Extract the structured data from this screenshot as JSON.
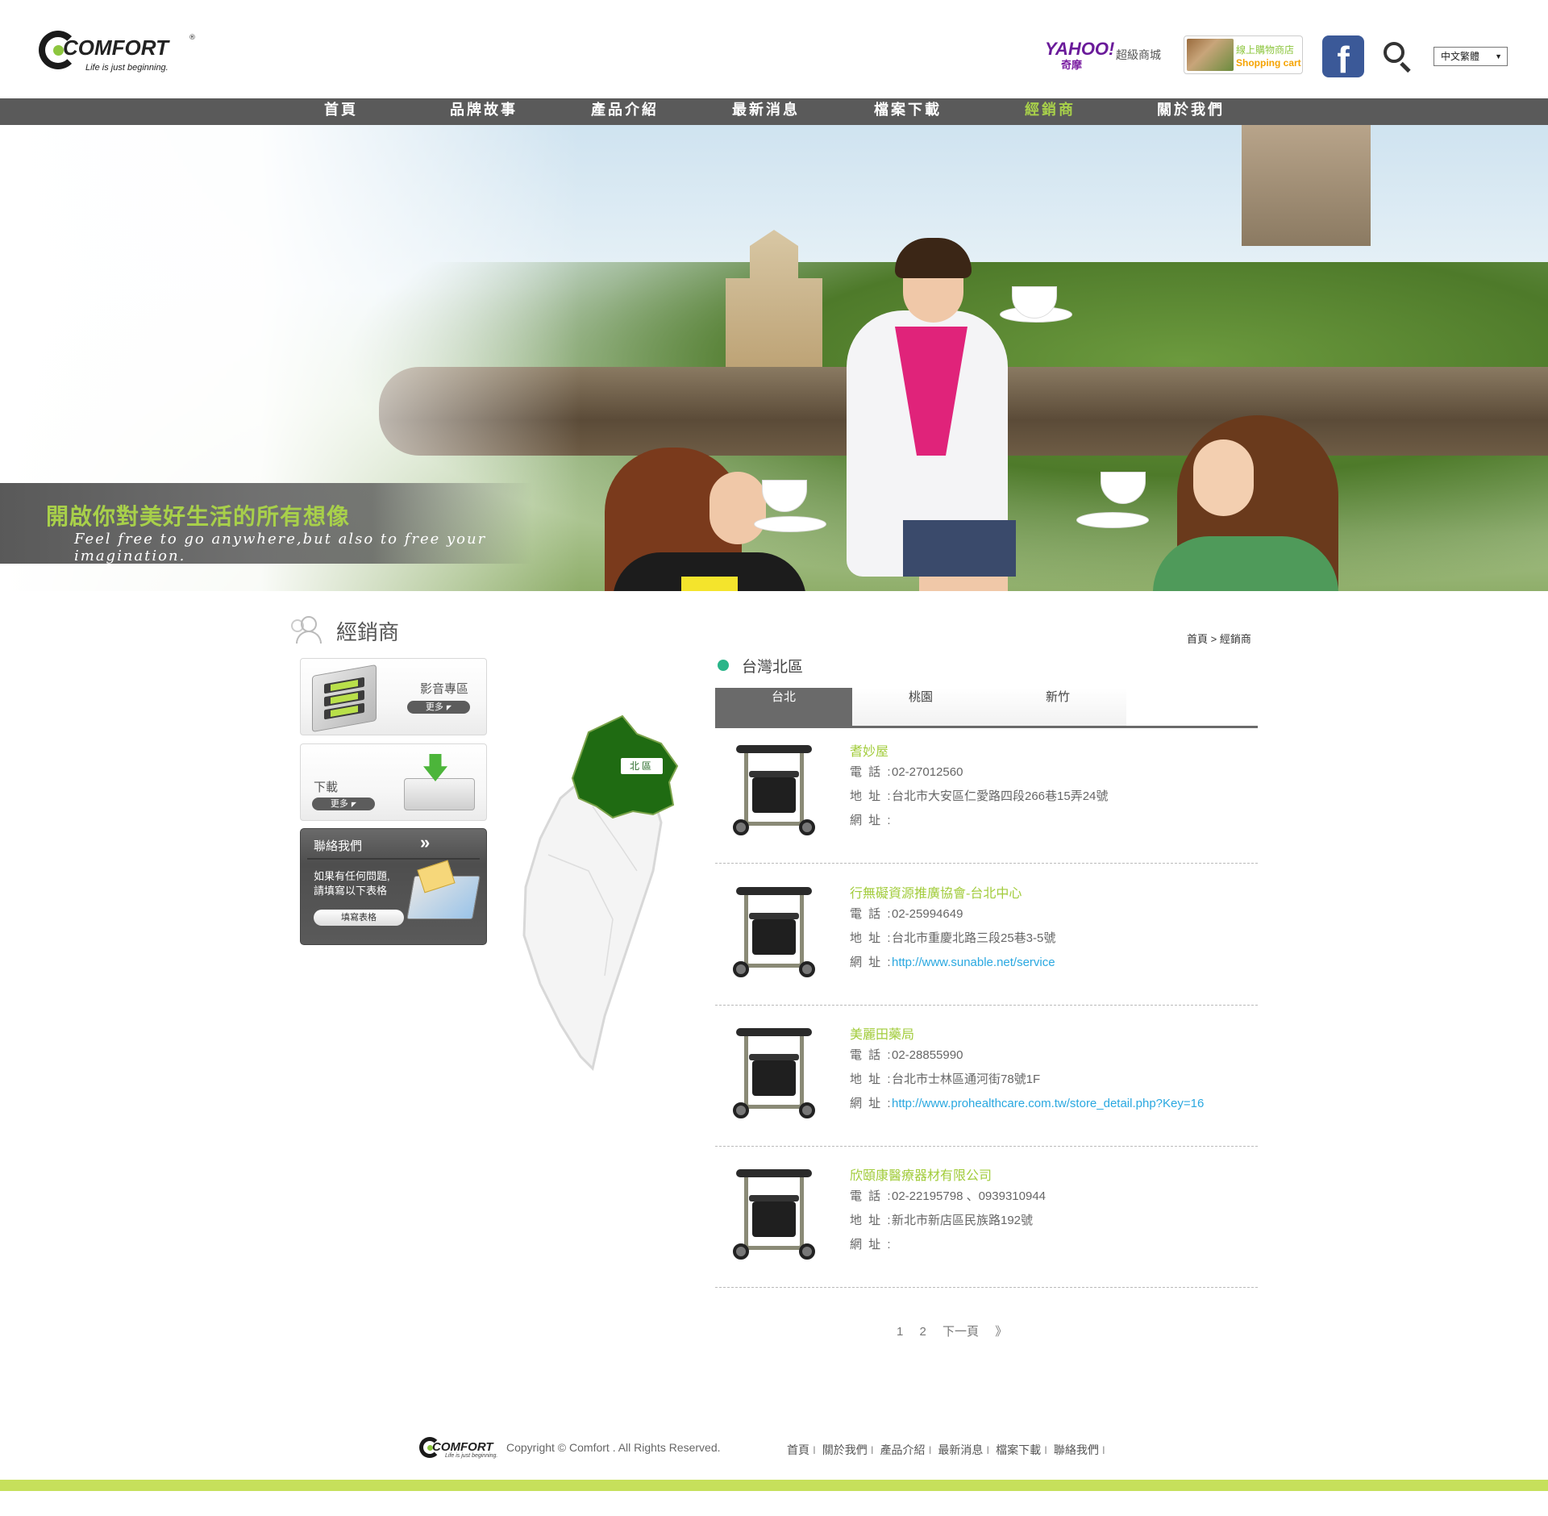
{
  "header": {
    "logo": {
      "word": "COMFORT",
      "reg": "®",
      "tagline": "Life is just beginning."
    },
    "yahoo": {
      "word": "YAHOO!",
      "sub": "奇摩",
      "label": "超級商城"
    },
    "shop": {
      "line1": "線上購物商店",
      "line2": "Shopping cart"
    },
    "facebook_glyph": "f",
    "language": {
      "selected": "中文繁體",
      "arrow": "▼"
    }
  },
  "nav": {
    "items": [
      {
        "label": "首頁",
        "active": false
      },
      {
        "label": "品牌故事",
        "active": false
      },
      {
        "label": "產品介紹",
        "active": false
      },
      {
        "label": "最新消息",
        "active": false
      },
      {
        "label": "檔案下載",
        "active": false
      },
      {
        "label": "經銷商",
        "active": true
      },
      {
        "label": "關於我們",
        "active": false
      }
    ]
  },
  "hero": {
    "title": "開啟你對美好生活的所有想像",
    "subtitle": "Feel free to go anywhere,but also to free your imagination."
  },
  "page": {
    "title": "經銷商",
    "breadcrumb": "首頁 > 經銷商"
  },
  "sidebar": {
    "media": {
      "label": "影音專區",
      "more": "更多",
      "arrow": "◤"
    },
    "download": {
      "label": "下載",
      "more": "更多",
      "arrow": "◤"
    },
    "contact": {
      "title": "聯絡我們",
      "chevron": "»",
      "text_line1": "如果有任何問題,",
      "text_line2": "請填寫以下表格",
      "button": "填寫表格"
    }
  },
  "map": {
    "region_label": "北區"
  },
  "section": {
    "title": "台灣北區"
  },
  "tabs": [
    {
      "label": "台北",
      "active": true
    },
    {
      "label": "桃園",
      "active": false
    },
    {
      "label": "新竹",
      "active": false
    }
  ],
  "labels": {
    "phone": "電 話 :",
    "address": "地 址 :",
    "website": "網 址 :"
  },
  "dealers": [
    {
      "name": "耆妙屋",
      "phone": "02-27012560",
      "address": "台北市大安區仁愛路四段266巷15弄24號",
      "website": ""
    },
    {
      "name": "行無礙資源推廣協會-台北中心",
      "phone": "02-25994649",
      "address": "台北市重慶北路三段25巷3-5號",
      "website": "http://www.sunable.net/service"
    },
    {
      "name": "美麗田藥局",
      "phone": "02-28855990",
      "address": "台北市士林區通河街78號1F",
      "website": "http://www.prohealthcare.com.tw/store_detail.php?Key=16"
    },
    {
      "name": "欣頤康醫療器材有限公司",
      "phone": "02-22195798 、0939310944",
      "address": "新北市新店區民族路192號",
      "website": ""
    }
  ],
  "pager": {
    "page1": "1",
    "page2": "2",
    "next": "下一頁",
    "next_arrow": "》"
  },
  "footer": {
    "copyright": "Copyright © Comfort . All Rights Reserved.",
    "links": [
      "首頁",
      "關於我們",
      "產品介紹",
      "最新消息",
      "檔案下載",
      "聯絡我們"
    ],
    "separator": "I"
  },
  "colors": {
    "accent_green": "#a8d04a",
    "nav_bg": "#5a5a5a",
    "link_blue": "#2aa8e0",
    "map_green": "#1f6b12",
    "footer_bar": "#c6e05b"
  }
}
